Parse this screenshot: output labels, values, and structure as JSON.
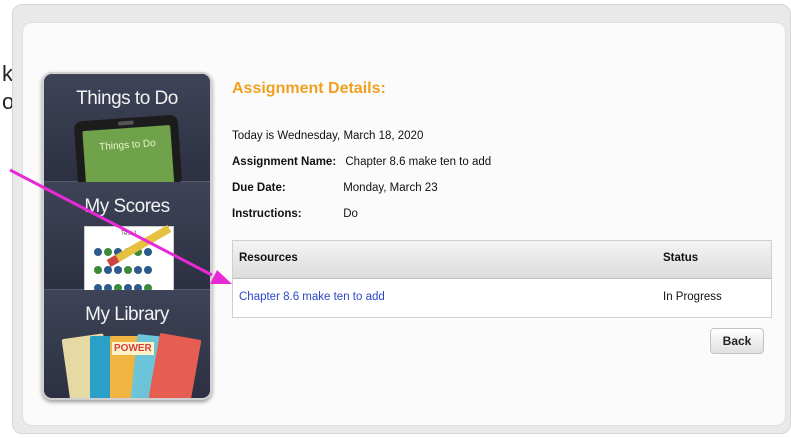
{
  "left_fragment": [
    "k",
    "o"
  ],
  "sidebar": {
    "items": [
      {
        "label": "Things to Do",
        "graphic_text": "Things to Do"
      },
      {
        "label": "My Scores",
        "graphic_text": "Test 1"
      },
      {
        "label": "My Library",
        "graphic_text": "POWER"
      }
    ]
  },
  "assignment": {
    "heading": "Assignment Details:",
    "today": "Today is Wednesday, March 18, 2020",
    "name_label": "Assignment Name:",
    "name_value": "Chapter 8.6 make ten to add",
    "due_label": "Due Date:",
    "due_value": "Monday, March 23",
    "instructions_label": "Instructions:",
    "instructions_value": "Do"
  },
  "resources_table": {
    "headers": {
      "resources": "Resources",
      "status": "Status"
    },
    "rows": [
      {
        "resource": "Chapter 8.6 make ten to add",
        "status": "In Progress"
      }
    ]
  },
  "buttons": {
    "back": "Back"
  },
  "colors": {
    "heading": "#f0a020",
    "link": "#2a47c8",
    "annotation_arrow": "#e82ad6",
    "sidebar": "#34384a"
  }
}
